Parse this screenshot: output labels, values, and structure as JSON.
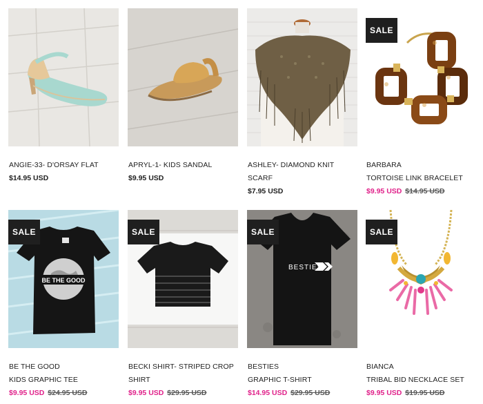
{
  "products": [
    {
      "name_line1": "ANGIE-33- D'ORSAY FLAT",
      "name_line2": "",
      "price": "$14.95 USD",
      "old_price": "",
      "badge": ""
    },
    {
      "name_line1": "APRYL-1- KIDS SANDAL",
      "name_line2": "",
      "price": "$9.95 USD",
      "old_price": "",
      "badge": ""
    },
    {
      "name_line1": "ASHLEY- DIAMOND KNIT",
      "name_line2": "SCARF",
      "price": "$7.95 USD",
      "old_price": "",
      "badge": ""
    },
    {
      "name_line1": "BARBARA",
      "name_line2": "TORTOISE LINK BRACELET",
      "price": "$9.95 USD",
      "old_price": "$14.95 USD",
      "badge": "SALE"
    },
    {
      "name_line1": "BE THE GOOD",
      "name_line2": "KIDS GRAPHIC TEE",
      "price": "$9.95 USD",
      "old_price": "$24.95 USD",
      "badge": "SALE"
    },
    {
      "name_line1": "BECKI SHIRT- STRIPED CROP",
      "name_line2": "SHIRT",
      "price": "$9.95 USD",
      "old_price": "$29.95 USD",
      "badge": "SALE"
    },
    {
      "name_line1": "BESTIES",
      "name_line2": "GRAPHIC T-SHIRT",
      "price": "$14.95 USD",
      "old_price": "$29.95 USD",
      "badge": "SALE"
    },
    {
      "name_line1": "BIANCA",
      "name_line2": "TRIBAL BID NECKLACE SET",
      "price": "$9.95 USD",
      "old_price": "$19.95 USD",
      "badge": "SALE"
    }
  ],
  "image_text": {
    "tee_print": "BE THE GOOD",
    "besties_print": "BESTIES"
  },
  "colors": {
    "sale_price": "#e0218a",
    "sale_badge_bg": "#1f1f1f"
  }
}
